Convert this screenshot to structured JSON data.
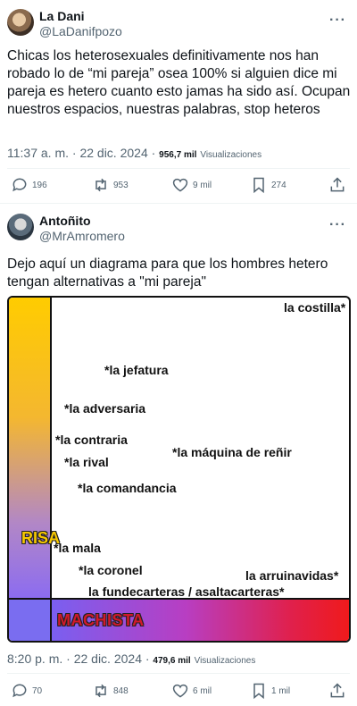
{
  "tweet1": {
    "name": "La Dani",
    "handle": "@LaDanifpozo",
    "text": "Chicas los heterosexuales definitivamente nos han robado lo de “mi pareja” osea 100% si alguien dice mi pareja es hetero cuanto esto jamas ha sido así. Ocupan nuestros espacios, nuestras palabras, stop heteros",
    "time": "11:37 a. m. · 22 dic. 2024 ·",
    "views_count": "956,7 mil",
    "views_label": "Visualizaciones",
    "replies": "196",
    "retweets": "953",
    "likes": "9 mil",
    "bookmarks": "274"
  },
  "tweet2": {
    "name": "Antoñito",
    "handle": "@MrAmromero",
    "text": "Dejo aquí un diagrama para que los hombres hetero tengan alternativas a \"mi pareja\"",
    "time": "8:20 p. m. · 22 dic. 2024 ·",
    "views_count": "479,6 mil",
    "views_label": "Visualizaciones",
    "replies": "70",
    "retweets": "848",
    "likes": "6 mil",
    "bookmarks": "1 mil"
  },
  "diagram": {
    "y_axis_label": "RISA",
    "x_axis_label": "MACHISTA",
    "colors": {
      "risa_top": "#ffcc00",
      "risa_bottom": "#8c6cf0",
      "machista_left": "#7a5ff0",
      "machista_right": "#f01a1a"
    },
    "labels": [
      "la costilla*",
      "*la jefatura",
      "*la adversaria",
      "*la contraria",
      "*la rival",
      "*la máquina de reñir",
      "*la comandancia",
      "*la mala",
      "*la coronel",
      "la arruinavidas*",
      "la fundecarteras / asaltacarteras*"
    ]
  }
}
